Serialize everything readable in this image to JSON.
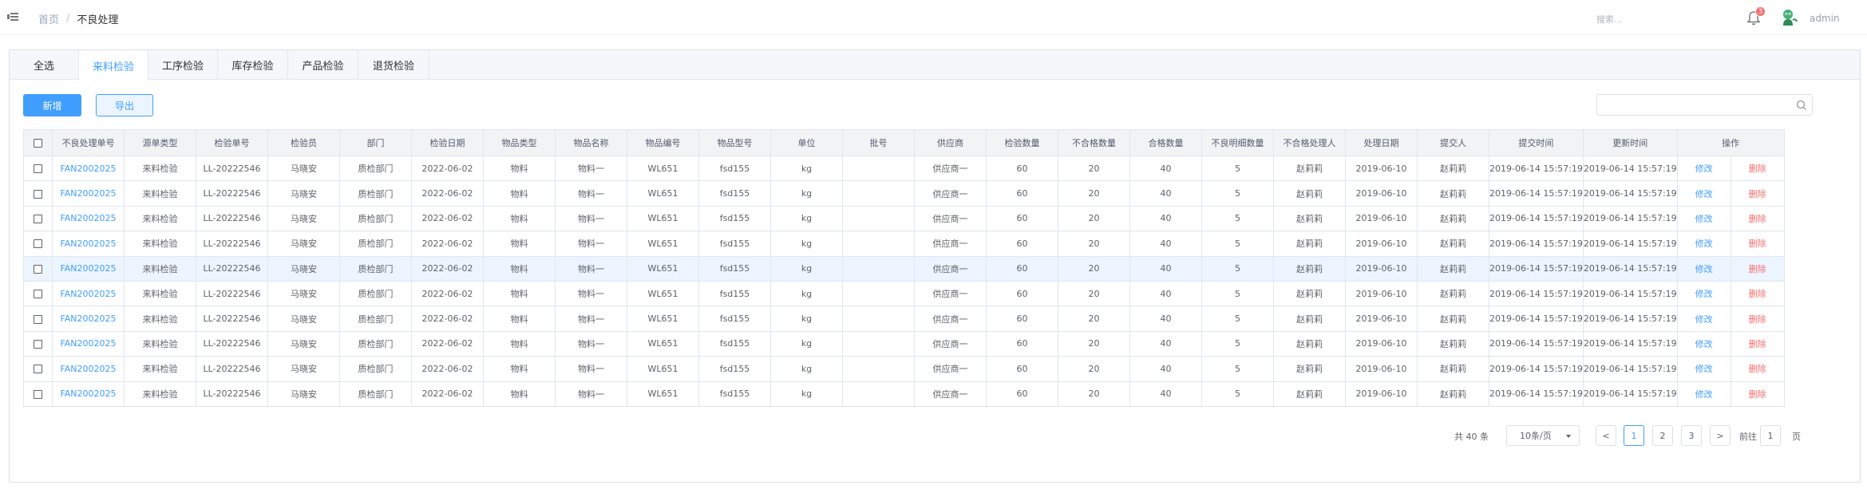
{
  "header": {
    "breadcrumb_home": "首页",
    "breadcrumb_sep": "/",
    "breadcrumb_current": "不良处理",
    "search_placeholder": "搜索...",
    "notification_count": "3",
    "username": "admin"
  },
  "tabs": [
    {
      "label": "全选"
    },
    {
      "label": "来料检验"
    },
    {
      "label": "工序检验"
    },
    {
      "label": "库存检验"
    },
    {
      "label": "产品检验"
    },
    {
      "label": "退货检验"
    }
  ],
  "active_tab": "来料检验",
  "toolbar": {
    "add_label": "新增",
    "export_label": "导出"
  },
  "table": {
    "headers": [
      "不良处理单号",
      "源单类型",
      "检验单号",
      "检验员",
      "部门",
      "检验日期",
      "物品类型",
      "物品名称",
      "物品编号",
      "物品型号",
      "单位",
      "批号",
      "供应商",
      "检验数量",
      "不合格数量",
      "合格数量",
      "不良明细数量",
      "不合格处理人",
      "处理日期",
      "提交人",
      "提交时间",
      "更新时间",
      "操作"
    ],
    "edit_label": "修改",
    "delete_label": "删除",
    "highlighted_row": 4,
    "rows": [
      [
        "FAN2002025",
        "来料检验",
        "LL-20222546",
        "马晓安",
        "质检部门",
        "2022-06-02",
        "物料",
        "物料一",
        "WL651",
        "fsd155",
        "kg",
        "",
        "供应商一",
        "60",
        "20",
        "40",
        "5",
        "赵莉莉",
        "2019-06-10",
        "赵莉莉",
        "2019-06-14 15:57:19",
        "2019-06-14 15:57:19"
      ],
      [
        "FAN2002025",
        "来料检验",
        "LL-20222546",
        "马晓安",
        "质检部门",
        "2022-06-02",
        "物料",
        "物料一",
        "WL651",
        "fsd155",
        "kg",
        "",
        "供应商一",
        "60",
        "20",
        "40",
        "5",
        "赵莉莉",
        "2019-06-10",
        "赵莉莉",
        "2019-06-14 15:57:19",
        "2019-06-14 15:57:19"
      ],
      [
        "FAN2002025",
        "来料检验",
        "LL-20222546",
        "马晓安",
        "质检部门",
        "2022-06-02",
        "物料",
        "物料一",
        "WL651",
        "fsd155",
        "kg",
        "",
        "供应商一",
        "60",
        "20",
        "40",
        "5",
        "赵莉莉",
        "2019-06-10",
        "赵莉莉",
        "2019-06-14 15:57:19",
        "2019-06-14 15:57:19"
      ],
      [
        "FAN2002025",
        "来料检验",
        "LL-20222546",
        "马晓安",
        "质检部门",
        "2022-06-02",
        "物料",
        "物料一",
        "WL651",
        "fsd155",
        "kg",
        "",
        "供应商一",
        "60",
        "20",
        "40",
        "5",
        "赵莉莉",
        "2019-06-10",
        "赵莉莉",
        "2019-06-14 15:57:19",
        "2019-06-14 15:57:19"
      ],
      [
        "FAN2002025",
        "来料检验",
        "LL-20222546",
        "马晓安",
        "质检部门",
        "2022-06-02",
        "物料",
        "物料一",
        "WL651",
        "fsd155",
        "kg",
        "",
        "供应商一",
        "60",
        "20",
        "40",
        "5",
        "赵莉莉",
        "2019-06-10",
        "赵莉莉",
        "2019-06-14 15:57:19",
        "2019-06-14 15:57:19"
      ],
      [
        "FAN2002025",
        "来料检验",
        "LL-20222546",
        "马晓安",
        "质检部门",
        "2022-06-02",
        "物料",
        "物料一",
        "WL651",
        "fsd155",
        "kg",
        "",
        "供应商一",
        "60",
        "20",
        "40",
        "5",
        "赵莉莉",
        "2019-06-10",
        "赵莉莉",
        "2019-06-14 15:57:19",
        "2019-06-14 15:57:19"
      ],
      [
        "FAN2002025",
        "来料检验",
        "LL-20222546",
        "马晓安",
        "质检部门",
        "2022-06-02",
        "物料",
        "物料一",
        "WL651",
        "fsd155",
        "kg",
        "",
        "供应商一",
        "60",
        "20",
        "40",
        "5",
        "赵莉莉",
        "2019-06-10",
        "赵莉莉",
        "2019-06-14 15:57:19",
        "2019-06-14 15:57:19"
      ],
      [
        "FAN2002025",
        "来料检验",
        "LL-20222546",
        "马晓安",
        "质检部门",
        "2022-06-02",
        "物料",
        "物料一",
        "WL651",
        "fsd155",
        "kg",
        "",
        "供应商一",
        "60",
        "20",
        "40",
        "5",
        "赵莉莉",
        "2019-06-10",
        "赵莉莉",
        "2019-06-14 15:57:19",
        "2019-06-14 15:57:19"
      ],
      [
        "FAN2002025",
        "来料检验",
        "LL-20222546",
        "马晓安",
        "质检部门",
        "2022-06-02",
        "物料",
        "物料一",
        "WL651",
        "fsd155",
        "kg",
        "",
        "供应商一",
        "60",
        "20",
        "40",
        "5",
        "赵莉莉",
        "2019-06-10",
        "赵莉莉",
        "2019-06-14 15:57:19",
        "2019-06-14 15:57:19"
      ],
      [
        "FAN2002025",
        "来料检验",
        "LL-20222546",
        "马晓安",
        "质检部门",
        "2022-06-02",
        "物料",
        "物料一",
        "WL651",
        "fsd155",
        "kg",
        "",
        "供应商一",
        "60",
        "20",
        "40",
        "5",
        "赵莉莉",
        "2019-06-10",
        "赵莉莉",
        "2019-06-14 15:57:19",
        "2019-06-14 15:57:19"
      ]
    ]
  },
  "pagination": {
    "total_text": "共 40 条",
    "page_size_text": "10条/页",
    "prev_label": "<",
    "next_label": ">",
    "pages": [
      "1",
      "2",
      "3"
    ],
    "current_page": "1",
    "goto_prefix": "前往",
    "goto_value": "1",
    "goto_suffix": "页"
  },
  "colors": {
    "primary": "#409eff",
    "danger": "#f56c6c",
    "row_highlight": "#ecf5ff",
    "header_bg": "#f2f3f5"
  }
}
